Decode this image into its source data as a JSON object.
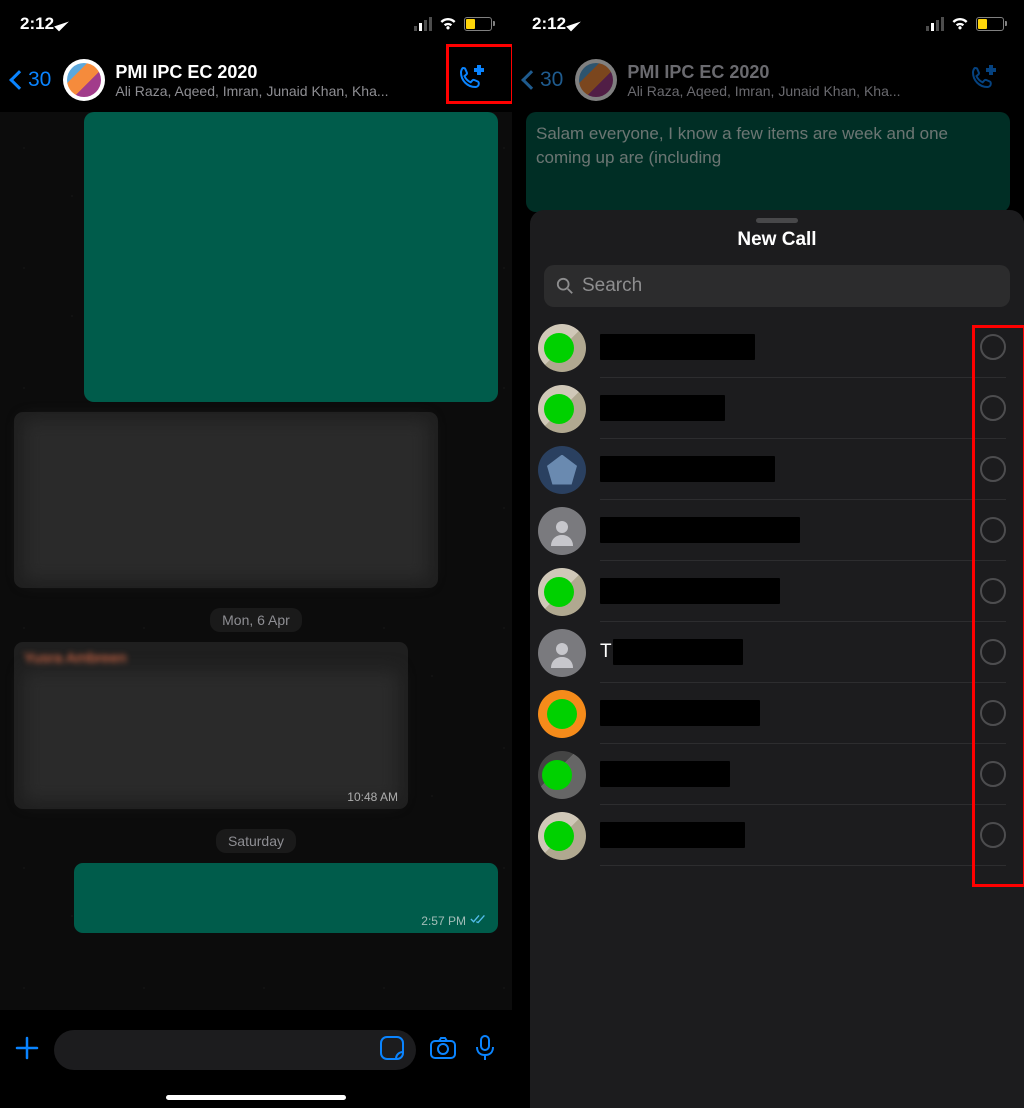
{
  "statusbar": {
    "time": "2:12"
  },
  "header": {
    "back_count": "30",
    "title": "PMI IPC EC 2020",
    "subtitle": "Ali Raza, Aqeed, Imran, Junaid Khan, Kha..."
  },
  "chat": {
    "date1": "Mon, 6 Apr",
    "date2": "Saturday",
    "sender1": "",
    "time1": "10:48 AM",
    "time2": "2:57 PM"
  },
  "behind_msg": "Salam everyone, I know a few items are\n\nweek and one coming up are (including",
  "sheet": {
    "title": "New Call",
    "search_placeholder": "Search",
    "contacts": [
      {
        "avatar_type": "green-photo",
        "name_width": 155,
        "letter": ""
      },
      {
        "avatar_type": "green-photo",
        "name_width": 125,
        "letter": ""
      },
      {
        "avatar_type": "logo-blue",
        "name_width": 175,
        "letter": ""
      },
      {
        "avatar_type": "placeholder",
        "name_width": 200,
        "letter": ""
      },
      {
        "avatar_type": "green-photo",
        "name_width": 180,
        "letter": ""
      },
      {
        "avatar_type": "placeholder",
        "name_width": 130,
        "letter": "T"
      },
      {
        "avatar_type": "orange-green",
        "name_width": 160,
        "letter": ""
      },
      {
        "avatar_type": "photo-green",
        "name_width": 130,
        "letter": ""
      },
      {
        "avatar_type": "green-photo",
        "name_width": 145,
        "letter": ""
      }
    ]
  }
}
